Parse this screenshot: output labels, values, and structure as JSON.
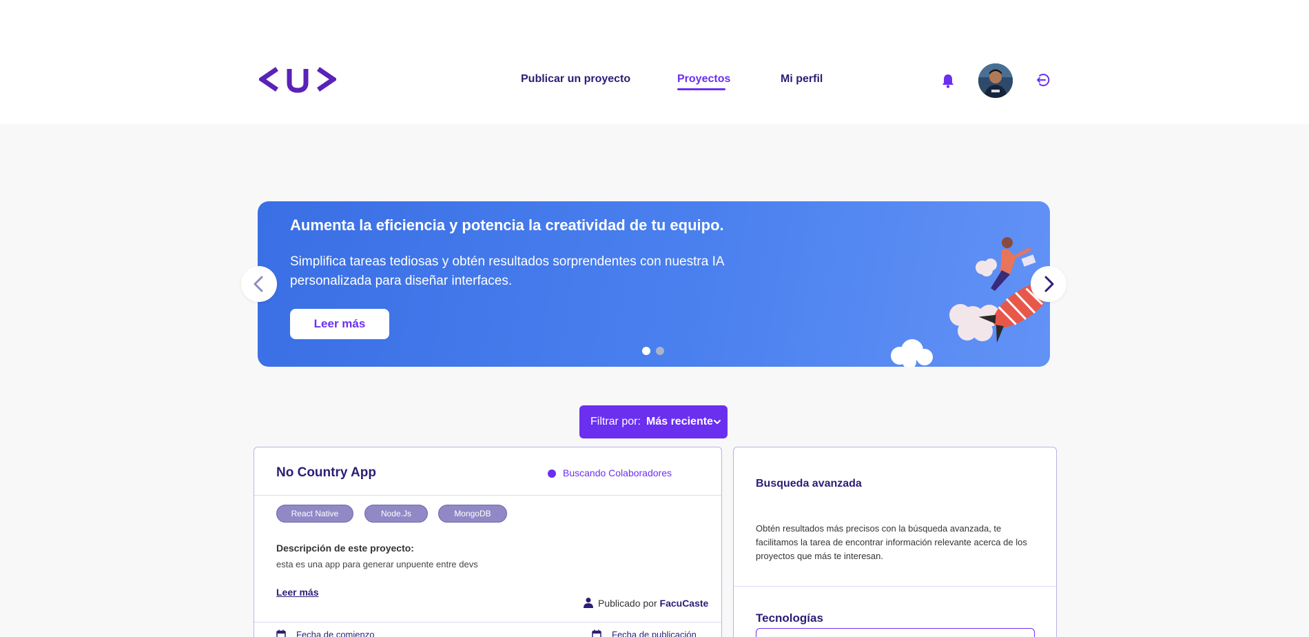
{
  "nav": {
    "publish": "Publicar un proyecto",
    "projects": "Proyectos",
    "profile": "Mi perfil"
  },
  "banner": {
    "title": "Aumenta la eficiencia y potencia la creatividad de tu equipo.",
    "text": "Simplifica tareas tediosas y obtén resultados sorprendentes con nuestra IA personalizada para diseñar interfaces.",
    "button": "Leer más"
  },
  "filter": {
    "label": "Filtrar por:",
    "value": "Más reciente"
  },
  "project": {
    "title": "No Country App",
    "status": "Buscando Colaboradores",
    "tags": [
      "React Native",
      "Node.Js",
      "MongoDB"
    ],
    "description_label": "Descripción de este proyecto:",
    "description": "esta es una app para generar unpuente entre devs",
    "read_more": "Leer más",
    "published_by_label": "Publicado por",
    "author": "FacuCaste",
    "start_date_label": "Fecha de comienzo",
    "publish_date_label": "Fecha de publicación"
  },
  "advanced_search": {
    "title": "Busqueda avanzada",
    "text": "Obtén resultados más precisos con la búsqueda avanzada, te facilitamos la tarea de encontrar información relevante acerca de los proyectos que más te interesan.",
    "technologies_label": "Tecnologías"
  },
  "colors": {
    "primary": "#6b2ff0",
    "navy": "#2a1e75",
    "banner_blue": "#3a6fe5",
    "tag": "#9089c6"
  }
}
